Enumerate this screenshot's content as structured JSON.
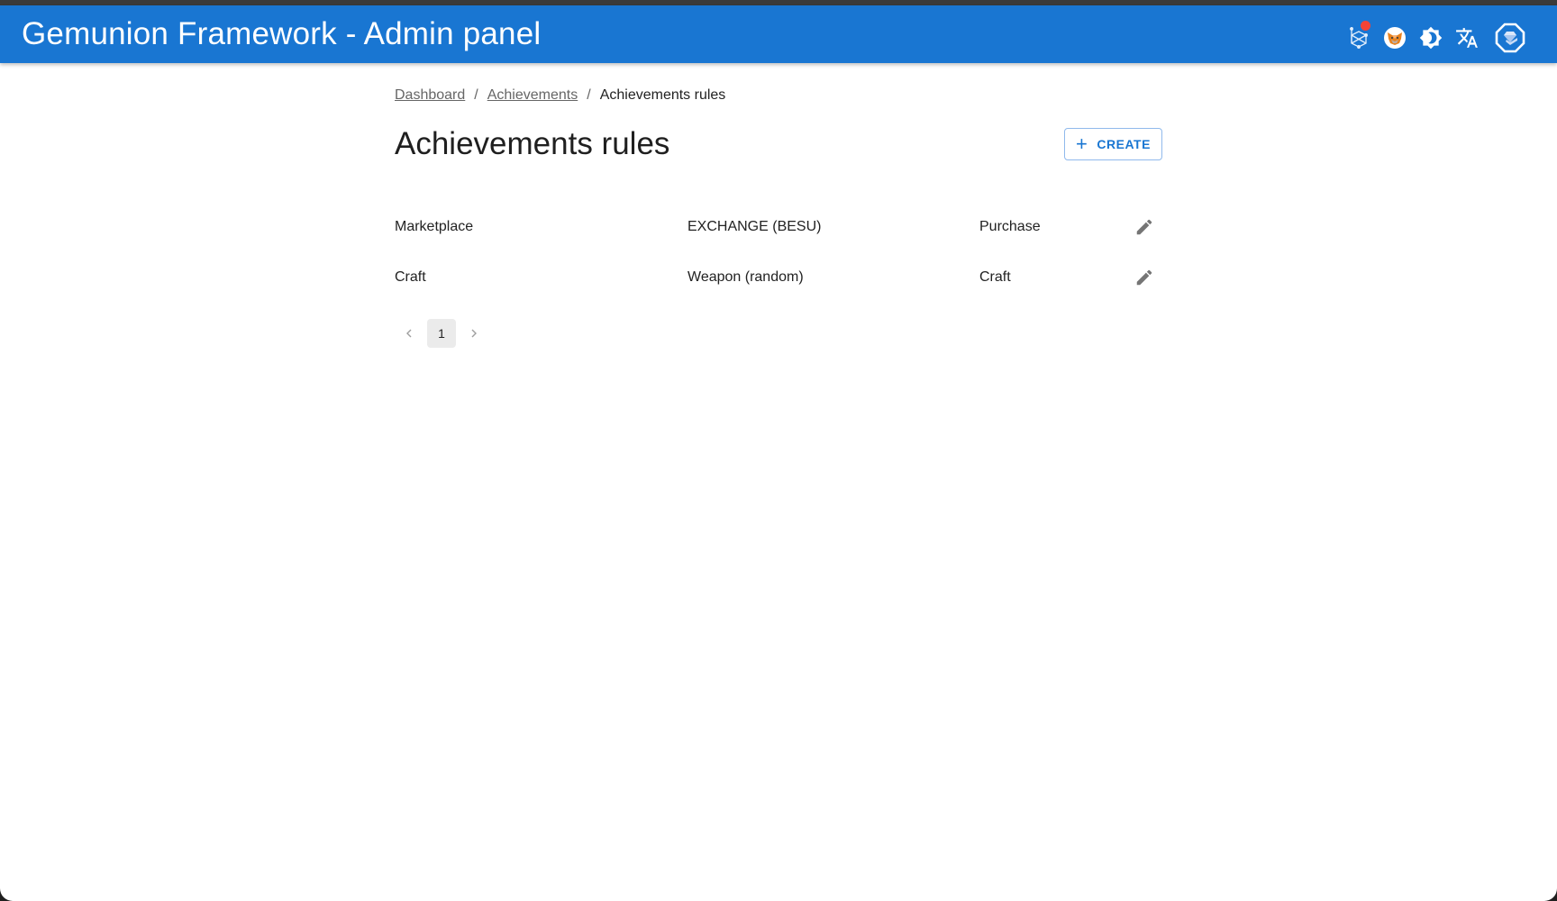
{
  "app": {
    "title": "Gemunion Framework - Admin panel",
    "colors": {
      "primary": "#1976d2",
      "badge": "#f44336"
    },
    "header_icons": [
      {
        "name": "network-icon",
        "has_badge": true
      },
      {
        "name": "metamask-icon"
      },
      {
        "name": "brightness-icon"
      },
      {
        "name": "translate-icon"
      },
      {
        "name": "account-octagon-icon"
      }
    ]
  },
  "breadcrumb": {
    "items": [
      "Dashboard",
      "Achievements"
    ],
    "current": "Achievements rules",
    "separator": "/"
  },
  "page": {
    "title": "Achievements rules",
    "create_label": "CREATE"
  },
  "rows": [
    {
      "name": "Marketplace",
      "item": "EXCHANGE (BESU)",
      "type": "Purchase"
    },
    {
      "name": "Craft",
      "item": "Weapon (random)",
      "type": "Craft"
    }
  ],
  "pagination": {
    "current_page": "1",
    "prev": "‹",
    "next": "›"
  }
}
